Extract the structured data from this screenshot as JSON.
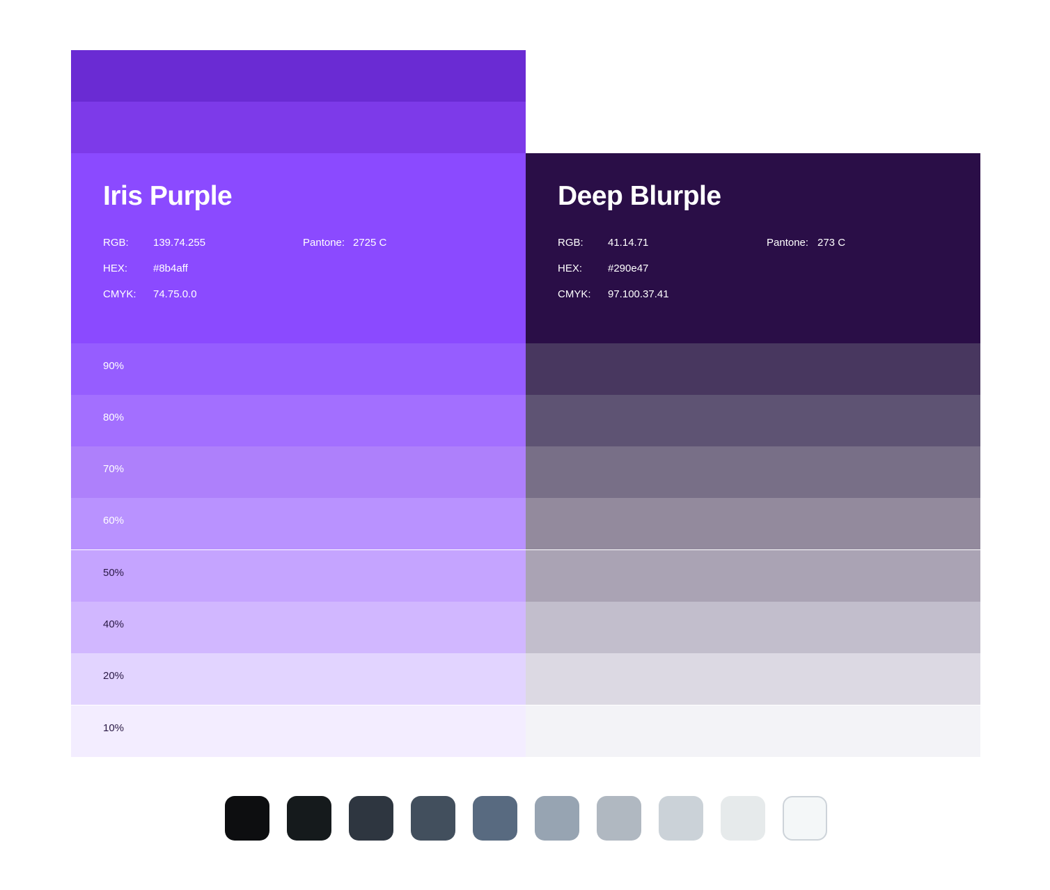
{
  "iris": {
    "name": "Iris Purple",
    "rgb_label": "RGB:",
    "rgb": "139.74.255",
    "hex_label": "HEX:",
    "hex": "#8b4aff",
    "cmyk_label": "CMYK:",
    "cmyk": "74.75.0.0",
    "pantone_label": "Pantone:",
    "pantone": "2725 C",
    "color": "#8b4aff",
    "shades": [
      "#6a2bd3",
      "#7d3ae9"
    ],
    "tints": [
      {
        "label": "90%",
        "color": "#965dff",
        "text_color": "#ffffff"
      },
      {
        "label": "80%",
        "color": "#a36fff",
        "text_color": "#ffffff"
      },
      {
        "label": "70%",
        "color": "#ae80fb",
        "text_color": "#ffffff"
      },
      {
        "label": "60%",
        "color": "#b992ff",
        "text_color": "#ffffff"
      },
      {
        "label": "50%",
        "color": "#c5a4ff",
        "text_color": "#2a1a45"
      },
      {
        "label": "40%",
        "color": "#d1b7ff",
        "text_color": "#2a1a45"
      },
      {
        "label": "20%",
        "color": "#e2d4ff",
        "text_color": "#2a1a45"
      },
      {
        "label": "10%",
        "color": "#f3edff",
        "text_color": "#2a1a45"
      }
    ]
  },
  "blurple": {
    "name": "Deep Blurple",
    "rgb_label": "RGB:",
    "rgb": "41.14.71",
    "hex_label": "HEX:",
    "hex": "#290e47",
    "cmyk_label": "CMYK:",
    "cmyk": "97.100.37.41",
    "pantone_label": "Pantone:",
    "pantone": "273 C",
    "color": "#2a0e47",
    "tints": [
      "#48375f",
      "#5e5373",
      "#786f87",
      "#938a9d",
      "#aaa3b4",
      "#c2becc",
      "#dcd9e3",
      "#f3f3f7"
    ]
  },
  "neutrals": [
    "#0d0e10",
    "#151a1c",
    "#2e3640",
    "#424f5d",
    "#586a80",
    "#97a4b2",
    "#b0b8c1",
    "#cbd2d8",
    "#e6eaeb",
    "#f4f7f8"
  ],
  "neutrals_last_border": "#cdd3d9"
}
